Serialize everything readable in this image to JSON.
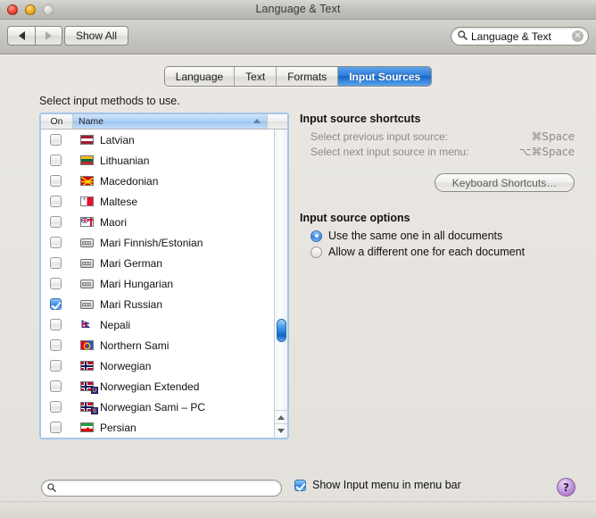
{
  "window": {
    "title": "Language & Text",
    "traffic_lights": [
      "close",
      "minimize",
      "zoom"
    ]
  },
  "toolbar": {
    "back_label": "◀",
    "forward_label": "▶",
    "show_all_label": "Show All",
    "search": {
      "value": "Language & Text",
      "placeholder": "Search",
      "icon": "search-icon",
      "clear_icon": "clear-icon"
    }
  },
  "tabs": [
    {
      "label": "Language",
      "active": false
    },
    {
      "label": "Text",
      "active": false
    },
    {
      "label": "Formats",
      "active": false
    },
    {
      "label": "Input Sources",
      "active": true
    }
  ],
  "main": {
    "select_label": "Select input methods to use.",
    "list": {
      "columns": [
        "On",
        "Name"
      ],
      "sort_column": "Name",
      "sort_direction": "ascending",
      "rows": [
        {
          "checked": false,
          "name": "Latvian",
          "icon": "flag-latvia"
        },
        {
          "checked": false,
          "name": "Lithuanian",
          "icon": "flag-lithuania"
        },
        {
          "checked": false,
          "name": "Macedonian",
          "icon": "flag-macedonia"
        },
        {
          "checked": false,
          "name": "Maltese",
          "icon": "flag-malta"
        },
        {
          "checked": false,
          "name": "Maori",
          "icon": "flag-maori"
        },
        {
          "checked": false,
          "name": "Mari Finnish/Estonian",
          "icon": "keyboard-icon"
        },
        {
          "checked": false,
          "name": "Mari German",
          "icon": "keyboard-icon"
        },
        {
          "checked": false,
          "name": "Mari Hungarian",
          "icon": "keyboard-icon"
        },
        {
          "checked": true,
          "name": "Mari Russian",
          "icon": "keyboard-icon"
        },
        {
          "checked": false,
          "name": "Nepali",
          "icon": "flag-nepal"
        },
        {
          "checked": false,
          "name": "Northern Sami",
          "icon": "flag-sami"
        },
        {
          "checked": false,
          "name": "Norwegian",
          "icon": "flag-norway"
        },
        {
          "checked": false,
          "name": "Norwegian Extended",
          "icon": "flag-norway",
          "badge": "U"
        },
        {
          "checked": false,
          "name": "Norwegian Sami – PC",
          "icon": "flag-norway",
          "badge": "S"
        },
        {
          "checked": false,
          "name": "Persian",
          "icon": "flag-iran"
        }
      ]
    }
  },
  "right_panel": {
    "shortcuts_title": "Input source shortcuts",
    "shortcuts": [
      {
        "label": "Select previous input source:",
        "key": "⌘Space"
      },
      {
        "label": "Select next input source in menu:",
        "key": "⌥⌘Space"
      }
    ],
    "keyboard_shortcuts_button": "Keyboard Shortcuts…",
    "options_title": "Input source options",
    "options": [
      {
        "label": "Use the same one in all documents",
        "selected": true
      },
      {
        "label": "Allow a different one for each document",
        "selected": false
      }
    ]
  },
  "bottom": {
    "search": {
      "value": "",
      "placeholder": "",
      "icon": "search-icon"
    },
    "show_input_menu": {
      "label": "Show Input menu in menu bar",
      "checked": true
    },
    "help_label": "?"
  },
  "colors": {
    "accent_blue": "#2f82de",
    "tab_active_blue": "#1666c8",
    "list_border": "#a5c6ea",
    "muted_text": "#8e8b86",
    "help_purple": "#9b63bd"
  }
}
